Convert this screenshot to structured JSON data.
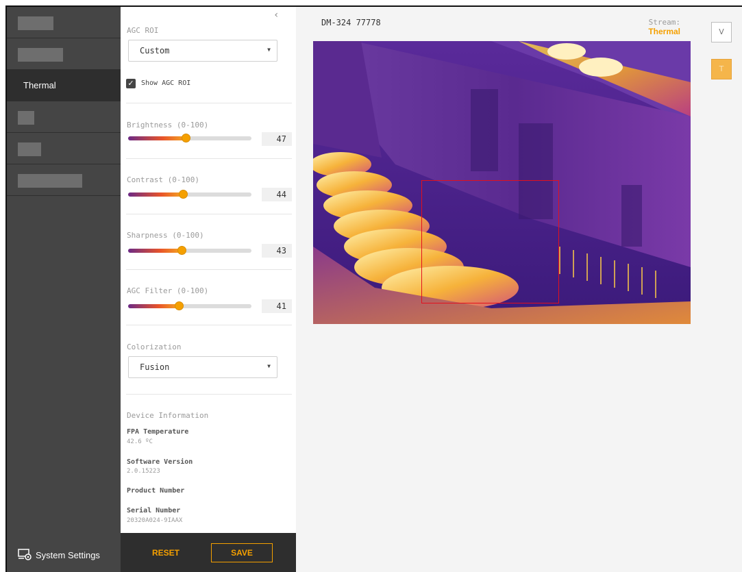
{
  "sidebar": {
    "items": [
      {
        "label": "",
        "redacted_width": 52
      },
      {
        "label": "",
        "redacted_width": 66
      },
      {
        "label": "Thermal",
        "active": true
      },
      {
        "label": "",
        "redacted_width": 24
      },
      {
        "label": "",
        "redacted_width": 34
      },
      {
        "label": "",
        "redacted_width": 94
      }
    ],
    "system_settings": "System Settings"
  },
  "panel": {
    "agc_roi_label": "AGC ROI",
    "agc_roi_value": "Custom",
    "show_agc_roi": "Show AGC ROI",
    "sliders": [
      {
        "label": "Brightness (0-100)",
        "value": 47
      },
      {
        "label": "Contrast (0-100)",
        "value": 44
      },
      {
        "label": "Sharpness (0-100)",
        "value": 43
      },
      {
        "label": "AGC Filter (0-100)",
        "value": 41
      }
    ],
    "colorization_label": "Colorization",
    "colorization_value": "Fusion",
    "device_info": {
      "title": "Device Information",
      "fpa_label": "FPA Temperature",
      "fpa_value": "42.6 ºC",
      "sw_label": "Software Version",
      "sw_value": "2.0.15223",
      "product_label": "Product Number",
      "serial_label": "Serial Number",
      "serial_value": "20320A024-9IAAX"
    },
    "reset": "RESET",
    "save": "SAVE"
  },
  "main": {
    "device_id": "DM-324 77778",
    "stream_label": "Stream:",
    "stream_value": "Thermal",
    "view_buttons": [
      "V",
      "T"
    ]
  },
  "colors": {
    "accent": "#f5a000",
    "sidebar": "#454545",
    "roi": "#e3101c"
  }
}
